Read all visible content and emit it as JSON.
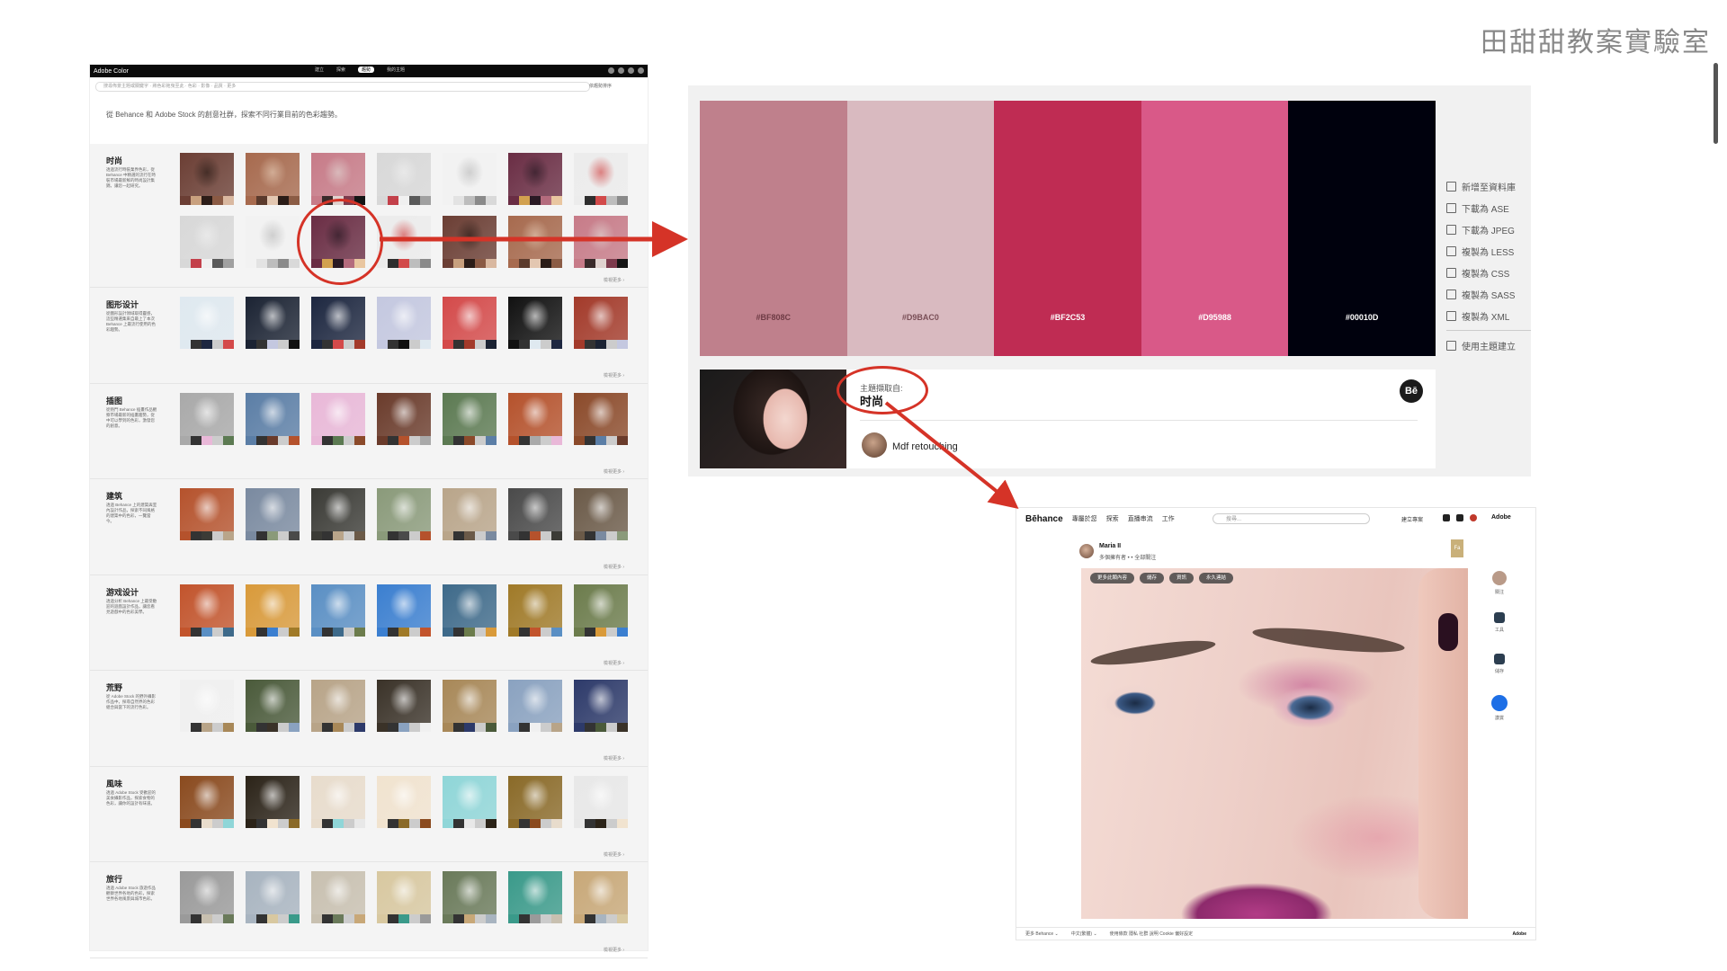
{
  "brand_title": "田甜甜教案實驗室",
  "adobe_color": {
    "logo": "Adobe Color",
    "nav": [
      "建立",
      "探索",
      "趨勢",
      "我的主題"
    ],
    "nav_active": 2,
    "search_placeholder": "搜尋佈景主題或關鍵字 · 將色彩拖曳至此 · 色彩 · 影像 · 品質 · 更多",
    "sort_label": "依趨勢排序",
    "intro": "從 Behance 和 Adobe Stock 的創意社群，探索不同行業目前的色彩趨勢。",
    "view_more": "檢視更多 ›",
    "categories": [
      {
        "title": "时尚",
        "desc": "透過流行時裝業界色彩，從 Behance 中精選的流行在時裝市場最新鮮的時尚設計集錦，讓您一起研究。"
      },
      {
        "title": "图形设计",
        "desc": "從圖形設計領域取得靈感，這些精選集來自最上了本次 Behance 上最流行使用的色彩趨勢。"
      },
      {
        "title": "插图",
        "desc": "從熱門 Behance 插畫作品觀察市場最新的插畫趨勢，從中可以學到的色彩，激發您的創意。"
      },
      {
        "title": "建筑",
        "desc": "透過 Behance 上的建築與室內設計作品，探索不同風格的建築中的色彩，一覽當今。"
      },
      {
        "title": "游戏设计",
        "desc": "透過分析 Behance 上最受歡迎的遊戲設計作品，讓您看見遊戲中的色彩美學。"
      },
      {
        "title": "荒野",
        "desc": "從 Adobe Stock 的野外攝影作品中，探尋自然界的色彩組合與當下的流行色彩。"
      },
      {
        "title": "風味",
        "desc": "透過 Adobe Stock 受歡迎的美食攝影作品，探索食物的色彩，讓你的設計有味道。"
      },
      {
        "title": "旅行",
        "desc": "透過 Adobe Stock 旅遊作品觀察世界各地的色彩，探索世界各地風景與城市色彩。"
      }
    ]
  },
  "theme": {
    "colors": [
      {
        "hex": "#BF808C",
        "text_color": "#6e3b45"
      },
      {
        "hex": "#D9BAC0",
        "text_color": "#7a4f57"
      },
      {
        "hex": "#BF2C53",
        "text_color": "#ffffff"
      },
      {
        "hex": "#D95988",
        "text_color": "#ffffff"
      },
      {
        "hex": "#00010D",
        "text_color": "#ffffff"
      }
    ],
    "actions": [
      "新增至資料庫",
      "下載為 ASE",
      "下載為 JPEG",
      "複製為 LESS",
      "複製為 CSS",
      "複製為 SASS",
      "複製為 XML"
    ],
    "create_action": "使用主題建立",
    "source_label": "主題擷取自:",
    "source_name": "时尚",
    "be_badge": "Bē",
    "author": "Mdf retouching"
  },
  "behance": {
    "logo": "Bēhance",
    "links": [
      "專屬於您",
      "探索",
      "直播串流",
      "工作"
    ],
    "search_placeholder": "搜尋...",
    "create": "建立專案",
    "adobe": "Adobe",
    "owner": "Maria II",
    "owner_sub": "多個擁有者 • • 全部關注",
    "badge": "Fa",
    "chips": [
      "更多此類內容",
      "儲存",
      "資訊",
      "永久連結"
    ],
    "side": [
      "關注",
      "工具",
      "儲存",
      "讚賞"
    ],
    "footer": [
      "更多 Behance ⌄",
      "中文(繁體) ⌄",
      "使用條款  隱私  社群  說明  Cookie 偏好設定"
    ],
    "footer_right": "Adobe"
  }
}
